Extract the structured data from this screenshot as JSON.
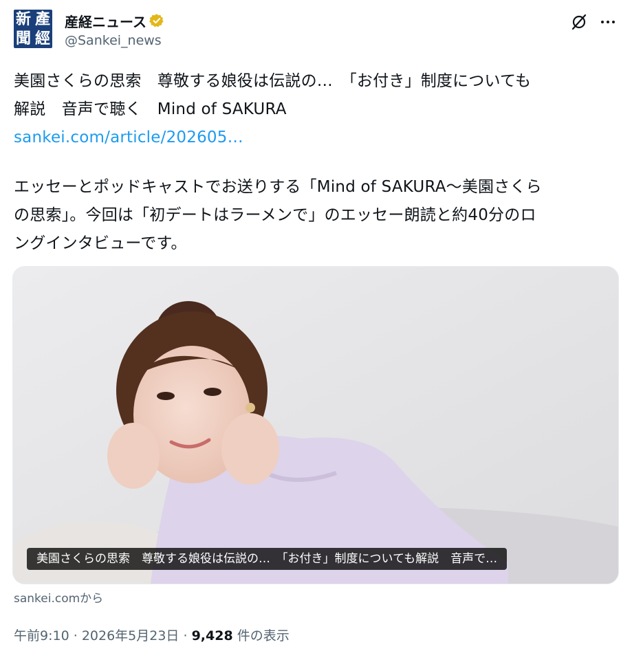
{
  "account": {
    "avatar_glyphs": [
      "新",
      "產",
      "聞",
      "經"
    ],
    "display_name": "産経ニュース",
    "handle": "@Sankei_news",
    "verified_color": "#e2b719"
  },
  "tweet": {
    "text_line1": "美園さくらの思索　尊敬する娘役は伝説の…　「お付き」制度についても\n解説　音声で聴く　Mind of SAKURA",
    "link_text": "sankei.com/article/202605…",
    "paragraph2": "エッセーとポッドキャストでお送りする「Mind of SAKURA～美園さくら\nの思索」。今回は「初デートはラーメンで」のエッセー朗読と約40分のロ\nングインタビューです。"
  },
  "card": {
    "caption": "美園さくらの思索　尊敬する娘役は伝説の…　「お付き」制度についても解説　音声で…",
    "source": "sankei.comから"
  },
  "meta": {
    "time": "午前9:10",
    "date": "2026年5月23日",
    "views_count": "9,428",
    "views_label": "件の表示",
    "sep": "·"
  },
  "colors": {
    "link": "#1d9bf0",
    "secondary_text": "#536471",
    "primary_text": "#0f1419",
    "avatar_bg": "#1a3f7a"
  },
  "icons": [
    "verified-badge-icon",
    "grok-icon",
    "more-icon"
  ]
}
